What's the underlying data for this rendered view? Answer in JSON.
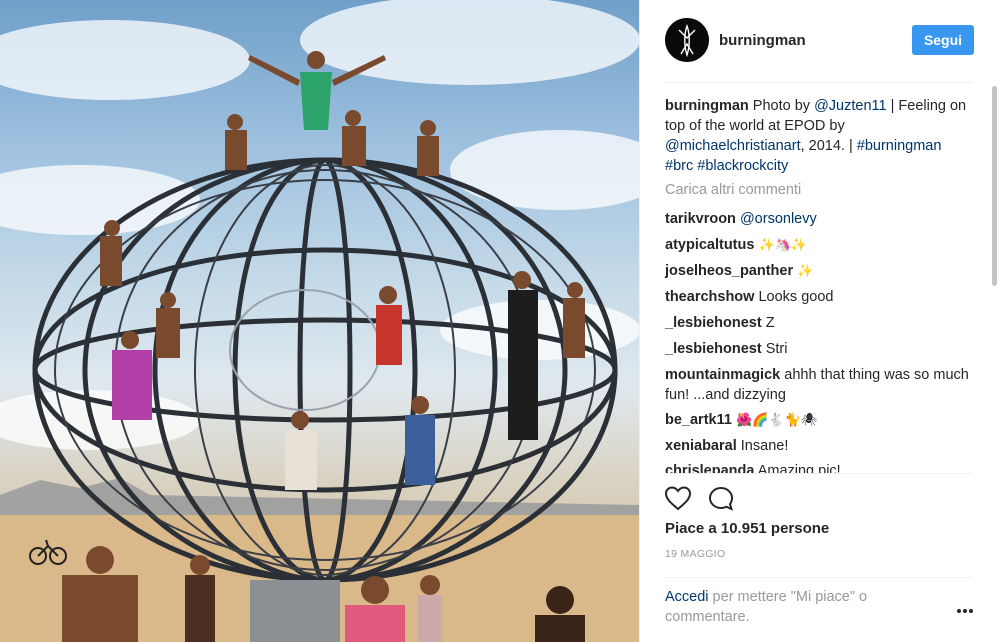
{
  "photo": {
    "sky_top": "#6f9fc9",
    "sand": "#caa77b"
  },
  "post": {
    "username": "burningman",
    "follow_label": "Segui",
    "caption": {
      "user": "burningman",
      "text_1": " Photo by ",
      "mention_1": "@Juzten11",
      "text_2": " | Feeling on top of the world at EPOD by ",
      "mention_2": "@michaelchristianart",
      "text_3": ", 2014. | ",
      "hashtag_1": "#burningman",
      "hashtag_2": "#brc",
      "hashtag_3": "#blackrockcity"
    },
    "load_more_label": "Carica altri commenti",
    "comments": [
      {
        "user": "tarikvroon",
        "text": "@orsonlevy",
        "text_is_link": true
      },
      {
        "user": "atypicaltutus",
        "text": "✨🦄✨"
      },
      {
        "user": "joselheos_panther",
        "text": "✨"
      },
      {
        "user": "thearchshow",
        "text": "Looks good"
      },
      {
        "user": "_lesbiehonest",
        "text": "Z"
      },
      {
        "user": "_lesbiehonest",
        "text": "Stri"
      },
      {
        "user": "mountainmagick",
        "text": "ahhh that thing was so much fun! ...and dizzying"
      },
      {
        "user": "be_artk11",
        "text": "🌺🌈🐇🐈🕷"
      },
      {
        "user": "xeniabaral",
        "text": "Insane!"
      },
      {
        "user": "chrislepanda",
        "text": "Amazing pic!"
      }
    ],
    "likes_label": "Piace a 10.951 persone",
    "date_label": "19 MAGGIO",
    "login_link": "Accedi",
    "login_text": " per mettere \"Mi piace\" o commentare.",
    "icons": {
      "heart": "heart-icon",
      "comment": "comment-icon",
      "more": "more-options-icon"
    },
    "colors": {
      "follow_button": "#3897f0",
      "link": "#003569",
      "muted": "#999999"
    }
  }
}
